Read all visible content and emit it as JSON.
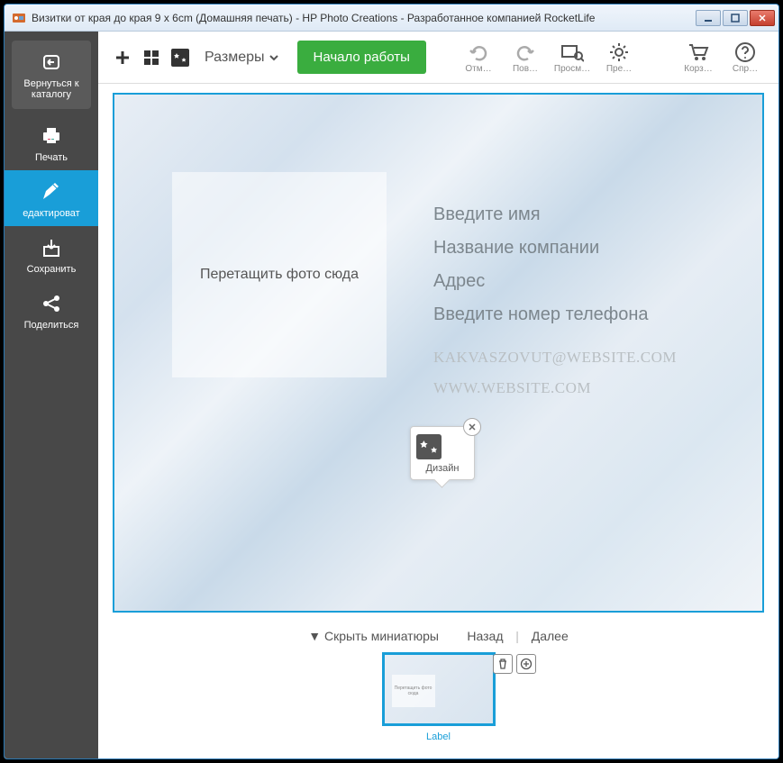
{
  "window": {
    "title": "Визитки от края до края 9 x 6cm (Домашняя печать) - HP Photo Creations - Разработанное компанией RocketLife"
  },
  "sidebar": {
    "back": "Вернуться к каталогу",
    "print": "Печать",
    "edit": "едактироват",
    "save": "Сохранить",
    "share": "Поделиться"
  },
  "topbar": {
    "sizes": "Размеры",
    "start": "Начало работы",
    "undo": "Отм…",
    "redo": "Пов…",
    "preview": "Просм…",
    "settings": "Пре…",
    "cart": "Корз…",
    "help": "Спр…"
  },
  "card": {
    "drop": "Перетащить фото сюда",
    "name": "Введите имя",
    "company": "Название компании",
    "address": "Адрес",
    "phone": "Введите номер телефона",
    "email": "KAKVASZOVUT@WEBSITE.COM",
    "website": "WWW.WEBSITE.COM"
  },
  "design_popup": {
    "label": "Дизайн"
  },
  "thumbs": {
    "hide": "▼ Скрыть миниатюры",
    "back": "Назад",
    "next": "Далее",
    "label": "Label",
    "mini_drop": "Перетащить фото сюда"
  }
}
